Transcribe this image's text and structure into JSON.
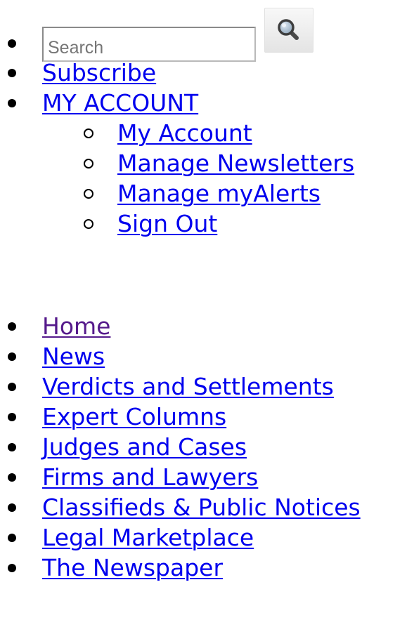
{
  "search": {
    "placeholder": "Search",
    "button_icon": "magnifier-icon"
  },
  "top_links": {
    "subscribe": "Subscribe",
    "my_account": "MY ACCOUNT"
  },
  "account_menu": [
    {
      "label": "My Account"
    },
    {
      "label": "Manage Newsletters"
    },
    {
      "label": "Manage myAlerts"
    },
    {
      "label": "Sign Out"
    }
  ],
  "main_nav": [
    {
      "label": "Home"
    },
    {
      "label": "News"
    },
    {
      "label": "Verdicts and Settlements"
    },
    {
      "label": "Expert Columns"
    },
    {
      "label": "Judges and Cases"
    },
    {
      "label": "Firms and Lawyers"
    },
    {
      "label": "Classifieds & Public Notices"
    },
    {
      "label": "Legal Marketplace"
    },
    {
      "label": "The Newspaper"
    }
  ],
  "colors": {
    "link": "#0000ee",
    "visited_link": "#551a8b"
  }
}
